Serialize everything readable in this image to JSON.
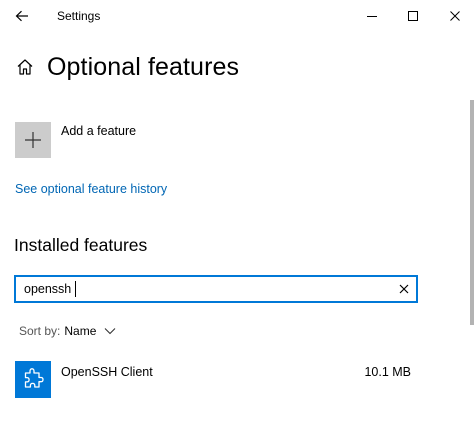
{
  "window": {
    "title": "Settings"
  },
  "header": {
    "title": "Optional features"
  },
  "add_feature": {
    "label": "Add a feature"
  },
  "history_link": {
    "label": "See optional feature history"
  },
  "installed": {
    "title": "Installed features",
    "search": {
      "value": "openssh",
      "placeholder": ""
    },
    "sort": {
      "label": "Sort by:",
      "value": "Name"
    },
    "items": [
      {
        "name": "OpenSSH Client",
        "size": "10.1 MB",
        "icon": "puzzle-icon"
      }
    ]
  },
  "colors": {
    "accent": "#0078d7",
    "link": "#0066b4",
    "tile_gray": "#cccccc"
  }
}
